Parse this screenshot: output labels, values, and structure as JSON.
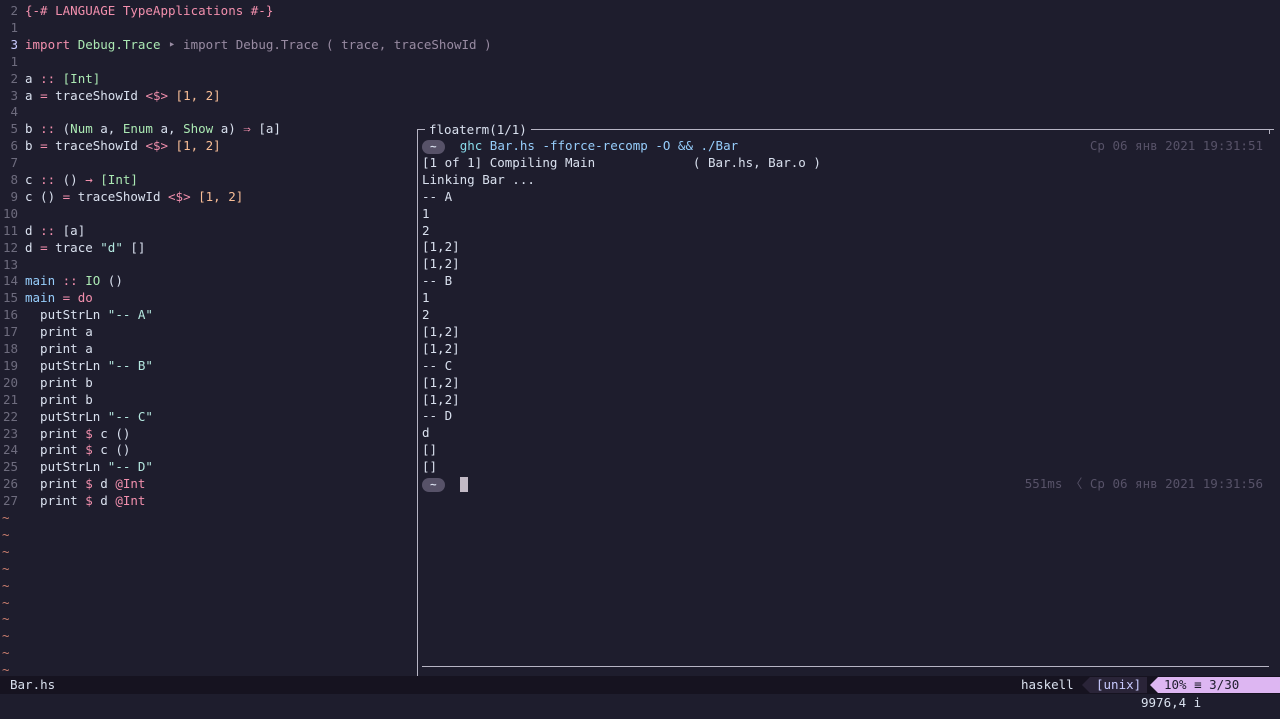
{
  "editor": {
    "lines": [
      {
        "n": "2",
        "segs": [
          [
            "pragma",
            "{-# LANGUAGE TypeApplications #-}"
          ]
        ]
      },
      {
        "n": "1",
        "segs": []
      },
      {
        "n": "3",
        "cur": true,
        "segs": [
          [
            "kw",
            "import "
          ],
          [
            "mod",
            "Debug.Trace"
          ],
          [
            "virt",
            " ‣ import Debug.Trace ( trace, traceShowId )"
          ]
        ]
      },
      {
        "n": "1",
        "segs": []
      },
      {
        "n": "2",
        "segs": [
          [
            "fn",
            "a "
          ],
          [
            "op",
            ":: "
          ],
          [
            "ty",
            "[Int]"
          ]
        ]
      },
      {
        "n": "3",
        "segs": [
          [
            "fn",
            "a "
          ],
          [
            "op",
            "= "
          ],
          [
            "fn",
            "traceShowId "
          ],
          [
            "op",
            "<$> "
          ],
          [
            "num",
            "[1, 2]"
          ]
        ]
      },
      {
        "n": "4",
        "segs": []
      },
      {
        "n": "5",
        "segs": [
          [
            "fn",
            "b "
          ],
          [
            "op",
            ":: "
          ],
          [
            "fn",
            "("
          ],
          [
            "ty",
            "Num "
          ],
          [
            "fn",
            "a, "
          ],
          [
            "ty",
            "Enum "
          ],
          [
            "fn",
            "a, "
          ],
          [
            "ty",
            "Show "
          ],
          [
            "fn",
            "a) "
          ],
          [
            "op",
            "⇒ "
          ],
          [
            "fn",
            "[a]"
          ]
        ]
      },
      {
        "n": "6",
        "segs": [
          [
            "fn",
            "b "
          ],
          [
            "op",
            "= "
          ],
          [
            "fn",
            "traceShowId "
          ],
          [
            "op",
            "<$> "
          ],
          [
            "num",
            "[1, 2]"
          ]
        ]
      },
      {
        "n": "7",
        "segs": []
      },
      {
        "n": "8",
        "segs": [
          [
            "fn",
            "c "
          ],
          [
            "op",
            ":: "
          ],
          [
            "fn",
            "() "
          ],
          [
            "op",
            "→ "
          ],
          [
            "ty",
            "[Int]"
          ]
        ]
      },
      {
        "n": "9",
        "segs": [
          [
            "fn",
            "c () "
          ],
          [
            "op",
            "= "
          ],
          [
            "fn",
            "traceShowId "
          ],
          [
            "op",
            "<$> "
          ],
          [
            "num",
            "[1, 2]"
          ]
        ]
      },
      {
        "n": "10",
        "segs": []
      },
      {
        "n": "11",
        "segs": [
          [
            "fn",
            "d "
          ],
          [
            "op",
            ":: "
          ],
          [
            "fn",
            "[a]"
          ]
        ]
      },
      {
        "n": "12",
        "segs": [
          [
            "fn",
            "d "
          ],
          [
            "op",
            "= "
          ],
          [
            "fn",
            "trace "
          ],
          [
            "str",
            "\"d\" "
          ],
          [
            "fn",
            "[]"
          ]
        ]
      },
      {
        "n": "13",
        "segs": []
      },
      {
        "n": "14",
        "segs": [
          [
            "par",
            "main "
          ],
          [
            "op",
            ":: "
          ],
          [
            "ty",
            "IO "
          ],
          [
            "fn",
            "()"
          ]
        ]
      },
      {
        "n": "15",
        "segs": [
          [
            "par",
            "main "
          ],
          [
            "op",
            "= "
          ],
          [
            "kw",
            "do"
          ]
        ]
      },
      {
        "n": "16",
        "segs": [
          [
            "fn",
            "  putStrLn "
          ],
          [
            "str",
            "\"-- A\""
          ]
        ]
      },
      {
        "n": "17",
        "segs": [
          [
            "fn",
            "  print a"
          ]
        ]
      },
      {
        "n": "18",
        "segs": [
          [
            "fn",
            "  print a"
          ]
        ]
      },
      {
        "n": "19",
        "segs": [
          [
            "fn",
            "  putStrLn "
          ],
          [
            "str",
            "\"-- B\""
          ]
        ]
      },
      {
        "n": "20",
        "segs": [
          [
            "fn",
            "  print b"
          ]
        ]
      },
      {
        "n": "21",
        "segs": [
          [
            "fn",
            "  print b"
          ]
        ]
      },
      {
        "n": "22",
        "segs": [
          [
            "fn",
            "  putStrLn "
          ],
          [
            "str",
            "\"-- C\""
          ]
        ]
      },
      {
        "n": "23",
        "segs": [
          [
            "fn",
            "  print "
          ],
          [
            "op",
            "$ "
          ],
          [
            "fn",
            "c ()"
          ]
        ]
      },
      {
        "n": "24",
        "segs": [
          [
            "fn",
            "  print "
          ],
          [
            "op",
            "$ "
          ],
          [
            "fn",
            "c ()"
          ]
        ]
      },
      {
        "n": "25",
        "segs": [
          [
            "fn",
            "  putStrLn "
          ],
          [
            "str",
            "\"-- D\""
          ]
        ]
      },
      {
        "n": "26",
        "segs": [
          [
            "fn",
            "  print "
          ],
          [
            "op",
            "$ "
          ],
          [
            "fn",
            "d "
          ],
          [
            "at",
            "@Int"
          ]
        ]
      },
      {
        "n": "27",
        "segs": [
          [
            "fn",
            "  print "
          ],
          [
            "op",
            "$ "
          ],
          [
            "fn",
            "d "
          ],
          [
            "at",
            "@Int"
          ]
        ]
      }
    ],
    "tilde_char": "~",
    "tilde_count": 10
  },
  "floaterm": {
    "title": "floaterm(1/1)",
    "prompt_symbol": "~",
    "command_ghc": "ghc",
    "command_rest": " Bar.hs -fforce-recomp -O && ./Bar",
    "first_timestamp": "Ср 06 янв 2021 19:31:51",
    "output": [
      "[1 of 1] Compiling Main             ( Bar.hs, Bar.o )",
      "Linking Bar ...",
      "-- A",
      "1",
      "2",
      "[1,2]",
      "[1,2]",
      "-- B",
      "1",
      "2",
      "[1,2]",
      "[1,2]",
      "-- C",
      "[1,2]",
      "[1,2]",
      "-- D",
      "d",
      "[]",
      "[]"
    ],
    "last_timestamp": "551ms 〈 Ср 06 янв 2021 19:31:56"
  },
  "statusline": {
    "filename": "Bar.hs",
    "filetype": "haskell",
    "fileformat": "[unix]",
    "position": "10% ≡ 3/30 ㏑:1"
  },
  "cmdline": {
    "text": "9976,4 i"
  }
}
